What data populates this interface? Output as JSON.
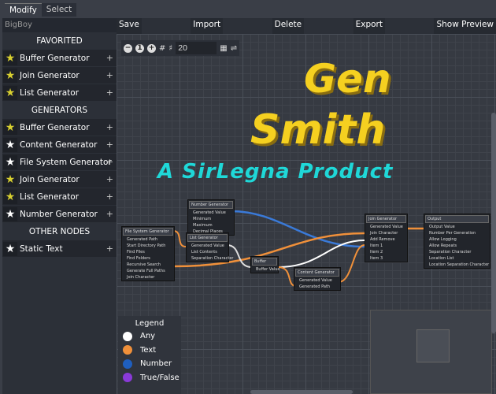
{
  "tabs": [
    "Modify",
    "Select"
  ],
  "sidebar": {
    "project": "BigBoy",
    "sections": [
      {
        "title": "FAVORITED",
        "items": [
          {
            "label": "Buffer Generator",
            "fav": true
          },
          {
            "label": "Join Generator",
            "fav": true
          },
          {
            "label": "List Generator",
            "fav": true
          }
        ]
      },
      {
        "title": "GENERATORS",
        "items": [
          {
            "label": "Buffer Generator",
            "fav": true
          },
          {
            "label": "Content Generator",
            "fav": false
          },
          {
            "label": "File System Generator",
            "fav": false
          },
          {
            "label": "Join Generator",
            "fav": true
          },
          {
            "label": "List Generator",
            "fav": true
          },
          {
            "label": "Number Generator",
            "fav": false
          }
        ]
      },
      {
        "title": "OTHER NODES",
        "items": [
          {
            "label": "Static Text",
            "fav": false
          }
        ]
      }
    ],
    "add_label": "+"
  },
  "toolbar": {
    "save": "Save",
    "import": "Import",
    "delete": "Delete",
    "export": "Export",
    "preview": "Show Preview"
  },
  "zoom": {
    "minus": "−",
    "reset": "1",
    "plus": "+",
    "snap_value": "20"
  },
  "logo": {
    "line1": "Gen",
    "line2": "Smith",
    "tagline": "A SirLegna Product"
  },
  "nodes": {
    "number": {
      "title": "Number Generator",
      "rows": [
        "Generated Value",
        "Minimum",
        "Maximum",
        "Decimal Places"
      ]
    },
    "filesystem": {
      "title": "File System Generator",
      "rows": [
        "Generated Path",
        "Start Directory Path",
        "Find Files",
        "Find Folders",
        "Recursive Search",
        "Generate Full Paths",
        "Join Character"
      ]
    },
    "list": {
      "title": "List Generator",
      "rows": [
        "Generated Value",
        "List Contents",
        "Separation Character"
      ]
    },
    "buffer": {
      "title": "Buffer",
      "rows": [
        "Buffer Value"
      ]
    },
    "content": {
      "title": "Content Generator",
      "rows": [
        "Generated Value",
        "Generated Path"
      ]
    },
    "join": {
      "title": "Join Generator",
      "rows": [
        "Generated Value",
        "Join Character",
        "Add    Remove",
        "Item 1",
        "Item 2",
        "Item 3"
      ]
    },
    "output": {
      "title": "Output",
      "rows": [
        "Output Value",
        "Number Per Generation",
        "Allow Logging",
        "Allow Repeats",
        "Separation Character",
        "Location List",
        "Location Separation Character"
      ]
    }
  },
  "legend": {
    "title": "Legend",
    "items": [
      {
        "label": "Any",
        "color": "#ffffff"
      },
      {
        "label": "Text",
        "color": "#f0903a"
      },
      {
        "label": "Number",
        "color": "#1f5fbf"
      },
      {
        "label": "True/False",
        "color": "#8a3ad8"
      }
    ]
  }
}
